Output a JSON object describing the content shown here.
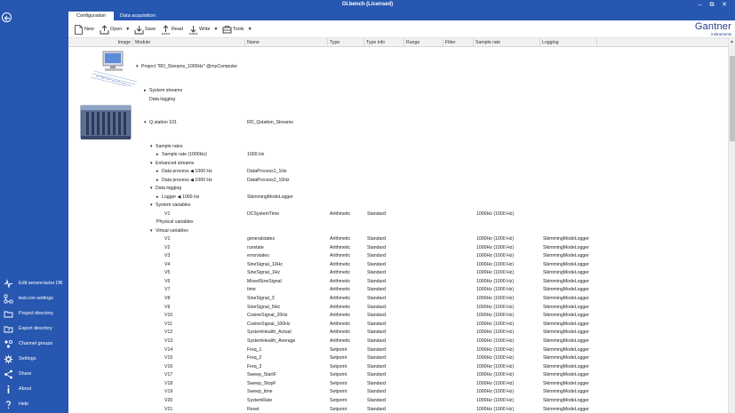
{
  "window": {
    "title": "GI.bench (Licensed)"
  },
  "tabs": [
    {
      "label": "Configuration",
      "active": true
    },
    {
      "label": "Data acquisition",
      "active": false
    }
  ],
  "toolbar": {
    "new_label": "New",
    "open_label": "Open",
    "save_label": "Save",
    "read_label": "Read",
    "write_label": "Write",
    "tools_label": "Tools"
  },
  "logo": {
    "brand": "Gantner",
    "sub": "instruments"
  },
  "sidebar": {
    "items": [
      {
        "label": "Edit sensor/actor DB",
        "icon": "sensor-icon"
      },
      {
        "label": "test.con settings",
        "icon": "network-icon"
      },
      {
        "label": "Project directory",
        "icon": "folder-icon"
      },
      {
        "label": "Export directory",
        "icon": "export-folder-icon"
      },
      {
        "label": "Channel groups",
        "icon": "channel-groups-icon"
      },
      {
        "label": "Settings",
        "icon": "gear-icon"
      },
      {
        "label": "Share",
        "icon": "share-icon"
      },
      {
        "label": "About",
        "icon": "info-icon"
      },
      {
        "label": "Help",
        "icon": "help-icon"
      }
    ]
  },
  "columns": [
    "Image",
    "Module",
    "Name",
    "Type",
    "Type info",
    "Range",
    "Filter",
    "Sample rate",
    "Logging"
  ],
  "tree": {
    "project": "Project \"RD_Streams_1000Hz\" @myComputer",
    "system_streams": "System streams",
    "data_logging_top": "Data logging",
    "device": "Q.station 101",
    "device_name": "RD_Qstation_Streams",
    "sample_rates": "Sample rates",
    "sample_rate_item": "Sample rate (1000Hz)",
    "sample_rate_value": "1000 Hz",
    "enhanced_streams": "Enhanced streams",
    "dp1": "Data process ◀ 1000 Hz",
    "dp1_name": "DataProcess1_1Hz",
    "dp2": "Data process ◀ 1000 Hz",
    "dp2_name": "DataProcess2_10Hz",
    "data_logging": "Data logging",
    "logger": "Logger ◀ 1000 Hz",
    "logger_name": "SkimmingModeLogger",
    "system_variables": "System variables",
    "sysvar": {
      "module": "V1",
      "name": "DCSystemTime",
      "type": "Arithmetic",
      "typeinfo": "Standard",
      "rate": "1000Hz (1000 Hz)"
    },
    "physical_variables": "Physical variables",
    "virtual_variables": "Virtual variables"
  },
  "virtual_rows": [
    {
      "module": "V1",
      "name": "generalstates",
      "type": "Arithmetic",
      "typeinfo": "Standard",
      "rate": "1000Hz (1000 Hz)",
      "logging": "SkimmingModeLogger"
    },
    {
      "module": "V2",
      "name": "runstate",
      "type": "Arithmetic",
      "typeinfo": "Standard",
      "rate": "1000Hz (1000 Hz)",
      "logging": "SkimmingModeLogger"
    },
    {
      "module": "V3",
      "name": "errorstates",
      "type": "Arithmetic",
      "typeinfo": "Standard",
      "rate": "1000Hz (1000 Hz)",
      "logging": "SkimmingModeLogger"
    },
    {
      "module": "V4",
      "name": "SineSignal_10Hz",
      "type": "Arithmetic",
      "typeinfo": "Standard",
      "rate": "1000Hz (1000 Hz)",
      "logging": "SkimmingModeLogger"
    },
    {
      "module": "V5",
      "name": "SineSignal_1Hz",
      "type": "Arithmetic",
      "typeinfo": "Standard",
      "rate": "1000Hz (1000 Hz)",
      "logging": "SkimmingModeLogger"
    },
    {
      "module": "V6",
      "name": "MixedSineSignal",
      "type": "Arithmetic",
      "typeinfo": "Standard",
      "rate": "1000Hz (1000 Hz)",
      "logging": "SkimmingModeLogger"
    },
    {
      "module": "V7",
      "name": "time",
      "type": "Arithmetic",
      "typeinfo": "Standard",
      "rate": "1000Hz (1000 Hz)",
      "logging": "SkimmingModeLogger"
    },
    {
      "module": "V8",
      "name": "SineSignal_3",
      "type": "Arithmetic",
      "typeinfo": "Standard",
      "rate": "1000Hz (1000 Hz)",
      "logging": "SkimmingModeLogger"
    },
    {
      "module": "V9",
      "name": "SineSignal_5Hz",
      "type": "Arithmetic",
      "typeinfo": "Standard",
      "rate": "1000Hz (1000 Hz)",
      "logging": "SkimmingModeLogger"
    },
    {
      "module": "V10",
      "name": "CosineSignal_20Hz",
      "type": "Arithmetic",
      "typeinfo": "Standard",
      "rate": "1000Hz (1000 Hz)",
      "logging": "SkimmingModeLogger"
    },
    {
      "module": "V11",
      "name": "CosineSignal_100Hz",
      "type": "Arithmetic",
      "typeinfo": "Standard",
      "rate": "1000Hz (1000 Hz)",
      "logging": "SkimmingModeLogger"
    },
    {
      "module": "V12",
      "name": "SystemHealth_Actual",
      "type": "Arithmetic",
      "typeinfo": "Standard",
      "rate": "1000Hz (1000 Hz)",
      "logging": "SkimmingModeLogger"
    },
    {
      "module": "V13",
      "name": "SystemHealth_Average",
      "type": "Arithmetic",
      "typeinfo": "Standard",
      "rate": "1000Hz (1000 Hz)",
      "logging": "SkimmingModeLogger"
    },
    {
      "module": "V14",
      "name": "Freq_1",
      "type": "Setpoint",
      "typeinfo": "Standard",
      "rate": "1000Hz (1000 Hz)",
      "logging": "SkimmingModeLogger"
    },
    {
      "module": "V15",
      "name": "Freq_2",
      "type": "Setpoint",
      "typeinfo": "Standard",
      "rate": "1000Hz (1000 Hz)",
      "logging": "SkimmingModeLogger"
    },
    {
      "module": "V16",
      "name": "Freq_3",
      "type": "Setpoint",
      "typeinfo": "Standard",
      "rate": "1000Hz (1000 Hz)",
      "logging": "SkimmingModeLogger"
    },
    {
      "module": "V17",
      "name": "Sweep_StartF",
      "type": "Setpoint",
      "typeinfo": "Standard",
      "rate": "1000Hz (1000 Hz)",
      "logging": "SkimmingModeLogger"
    },
    {
      "module": "V18",
      "name": "Sweep_StopF",
      "type": "Setpoint",
      "typeinfo": "Standard",
      "rate": "1000Hz (1000 Hz)",
      "logging": "SkimmingModeLogger"
    },
    {
      "module": "V19",
      "name": "Sweep_time",
      "type": "Setpoint",
      "typeinfo": "Standard",
      "rate": "1000Hz (1000 Hz)",
      "logging": "SkimmingModeLogger"
    },
    {
      "module": "V20",
      "name": "SystemRate",
      "type": "Setpoint",
      "typeinfo": "Standard",
      "rate": "1000Hz (1000 Hz)",
      "logging": "SkimmingModeLogger"
    },
    {
      "module": "V21",
      "name": "Reset",
      "type": "Setpoint",
      "typeinfo": "Standard",
      "rate": "1000Hz (1000 Hz)",
      "logging": "SkimmingModeLogger"
    }
  ],
  "colors": {
    "accent": "#2757b0",
    "brand": "#1f3c8a"
  }
}
